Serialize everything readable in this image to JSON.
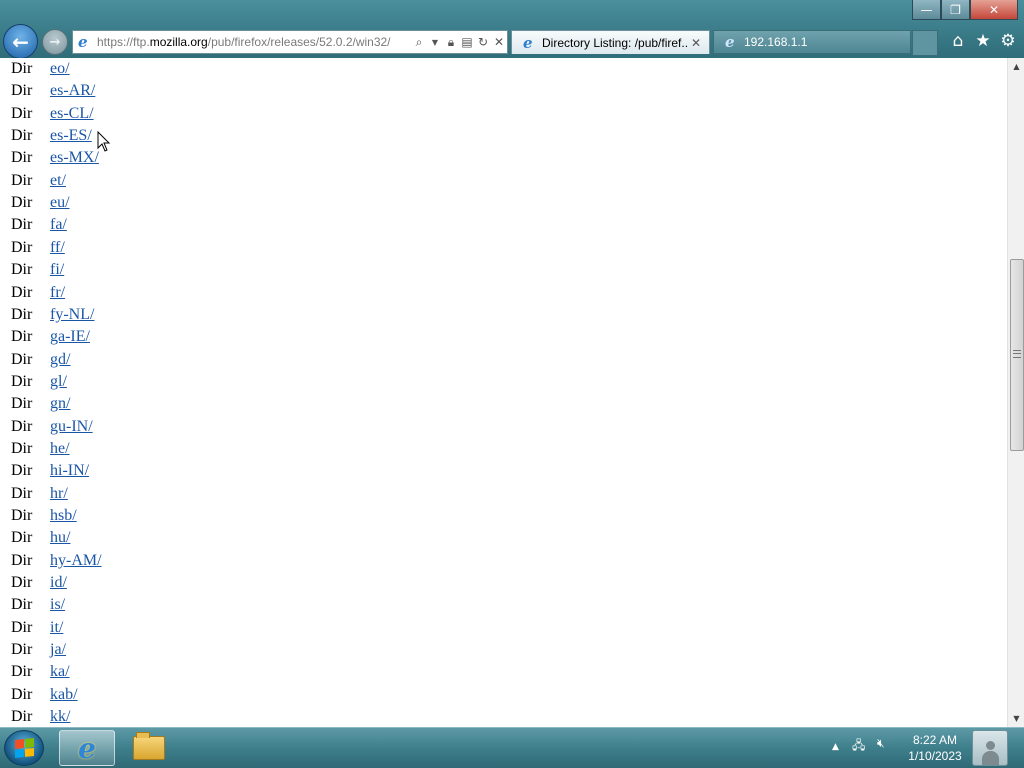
{
  "window": {
    "controls": {
      "minimize": "—",
      "maximize": "❐",
      "close": "✕"
    }
  },
  "nav": {
    "back_glyph": "←",
    "forward_glyph": "→"
  },
  "address": {
    "url_prefix": "https://ftp.",
    "url_domain": "mozilla.org",
    "url_path": "/pub/firefox/releases/52.0.2/win32/",
    "icons": [
      "search-icon",
      "dropdown-icon",
      "lock-icon",
      "compat-icon",
      "refresh-icon",
      "stop-icon"
    ]
  },
  "tabs": [
    {
      "title": "Directory Listing: /pub/firef...",
      "active": true,
      "close": "✕"
    },
    {
      "title": "192.168.1.1",
      "active": false
    }
  ],
  "toolbar": {
    "home": "⌂",
    "favorites": "★",
    "tools": "⚙"
  },
  "listing": [
    {
      "type": "Dir",
      "name": "eo/"
    },
    {
      "type": "Dir",
      "name": "es-AR/"
    },
    {
      "type": "Dir",
      "name": "es-CL/"
    },
    {
      "type": "Dir",
      "name": "es-ES/"
    },
    {
      "type": "Dir",
      "name": "es-MX/"
    },
    {
      "type": "Dir",
      "name": "et/"
    },
    {
      "type": "Dir",
      "name": "eu/"
    },
    {
      "type": "Dir",
      "name": "fa/"
    },
    {
      "type": "Dir",
      "name": "ff/"
    },
    {
      "type": "Dir",
      "name": "fi/"
    },
    {
      "type": "Dir",
      "name": "fr/"
    },
    {
      "type": "Dir",
      "name": "fy-NL/"
    },
    {
      "type": "Dir",
      "name": "ga-IE/"
    },
    {
      "type": "Dir",
      "name": "gd/"
    },
    {
      "type": "Dir",
      "name": "gl/"
    },
    {
      "type": "Dir",
      "name": "gn/"
    },
    {
      "type": "Dir",
      "name": "gu-IN/"
    },
    {
      "type": "Dir",
      "name": "he/"
    },
    {
      "type": "Dir",
      "name": "hi-IN/"
    },
    {
      "type": "Dir",
      "name": "hr/"
    },
    {
      "type": "Dir",
      "name": "hsb/"
    },
    {
      "type": "Dir",
      "name": "hu/"
    },
    {
      "type": "Dir",
      "name": "hy-AM/"
    },
    {
      "type": "Dir",
      "name": "id/"
    },
    {
      "type": "Dir",
      "name": "is/"
    },
    {
      "type": "Dir",
      "name": "it/"
    },
    {
      "type": "Dir",
      "name": "ja/"
    },
    {
      "type": "Dir",
      "name": "ka/"
    },
    {
      "type": "Dir",
      "name": "kab/"
    },
    {
      "type": "Dir",
      "name": "kk/"
    }
  ],
  "scrollbar": {
    "up": "▲",
    "down": "▼"
  },
  "taskbar": {
    "ie_glyph": "e",
    "tray": {
      "expand": "▲",
      "network": "network-icon",
      "volume": "volume-muted-icon"
    },
    "time": "8:22 AM",
    "date": "1/10/2023"
  }
}
